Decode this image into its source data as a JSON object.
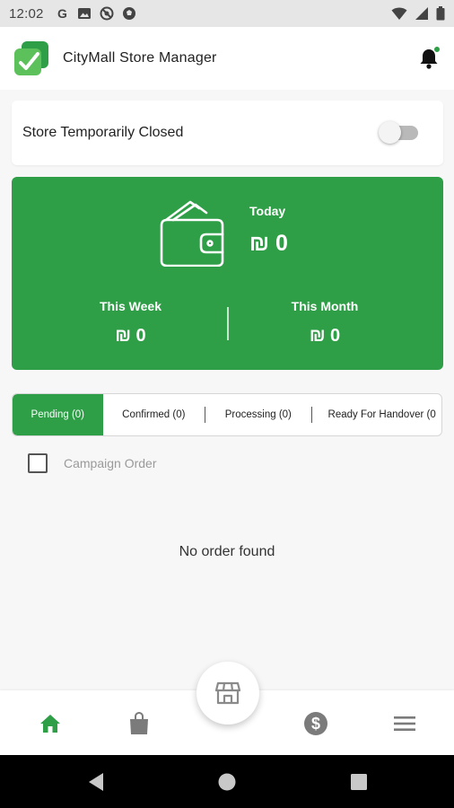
{
  "status_bar": {
    "time": "12:02",
    "icons": [
      "google-icon",
      "photo-icon",
      "target-icon",
      "soccer-icon"
    ],
    "right_icons": [
      "wifi-icon",
      "signal-icon",
      "battery-icon"
    ]
  },
  "header": {
    "title": "CityMall Store Manager",
    "logo_icon": "citymall-logo",
    "notification_icon": "bell-icon"
  },
  "store_status": {
    "label": "Store Temporarily Closed",
    "toggle_on": false
  },
  "earnings": {
    "today_label": "Today",
    "today_value": "₪ 0",
    "week_label": "This Week",
    "week_value": "₪ 0",
    "month_label": "This Month",
    "month_value": "₪ 0",
    "icon": "wallet-icon"
  },
  "tabs": [
    {
      "label": "Pending (0)",
      "active": true
    },
    {
      "label": "Confirmed (0)",
      "active": false
    },
    {
      "label": "Processing (0)",
      "active": false
    },
    {
      "label": "Ready For Handover (0",
      "active": false
    }
  ],
  "filter": {
    "campaign_label": "Campaign Order",
    "checked": false
  },
  "empty_message": "No order found",
  "bottom_nav": {
    "items": [
      "home-icon",
      "bag-icon",
      "store-icon",
      "dollar-icon",
      "menu-icon"
    ],
    "active": "home-icon"
  },
  "colors": {
    "accent": "#2e9e47",
    "background": "#f7f7f7",
    "inactive_icon": "#7b7b7b"
  }
}
